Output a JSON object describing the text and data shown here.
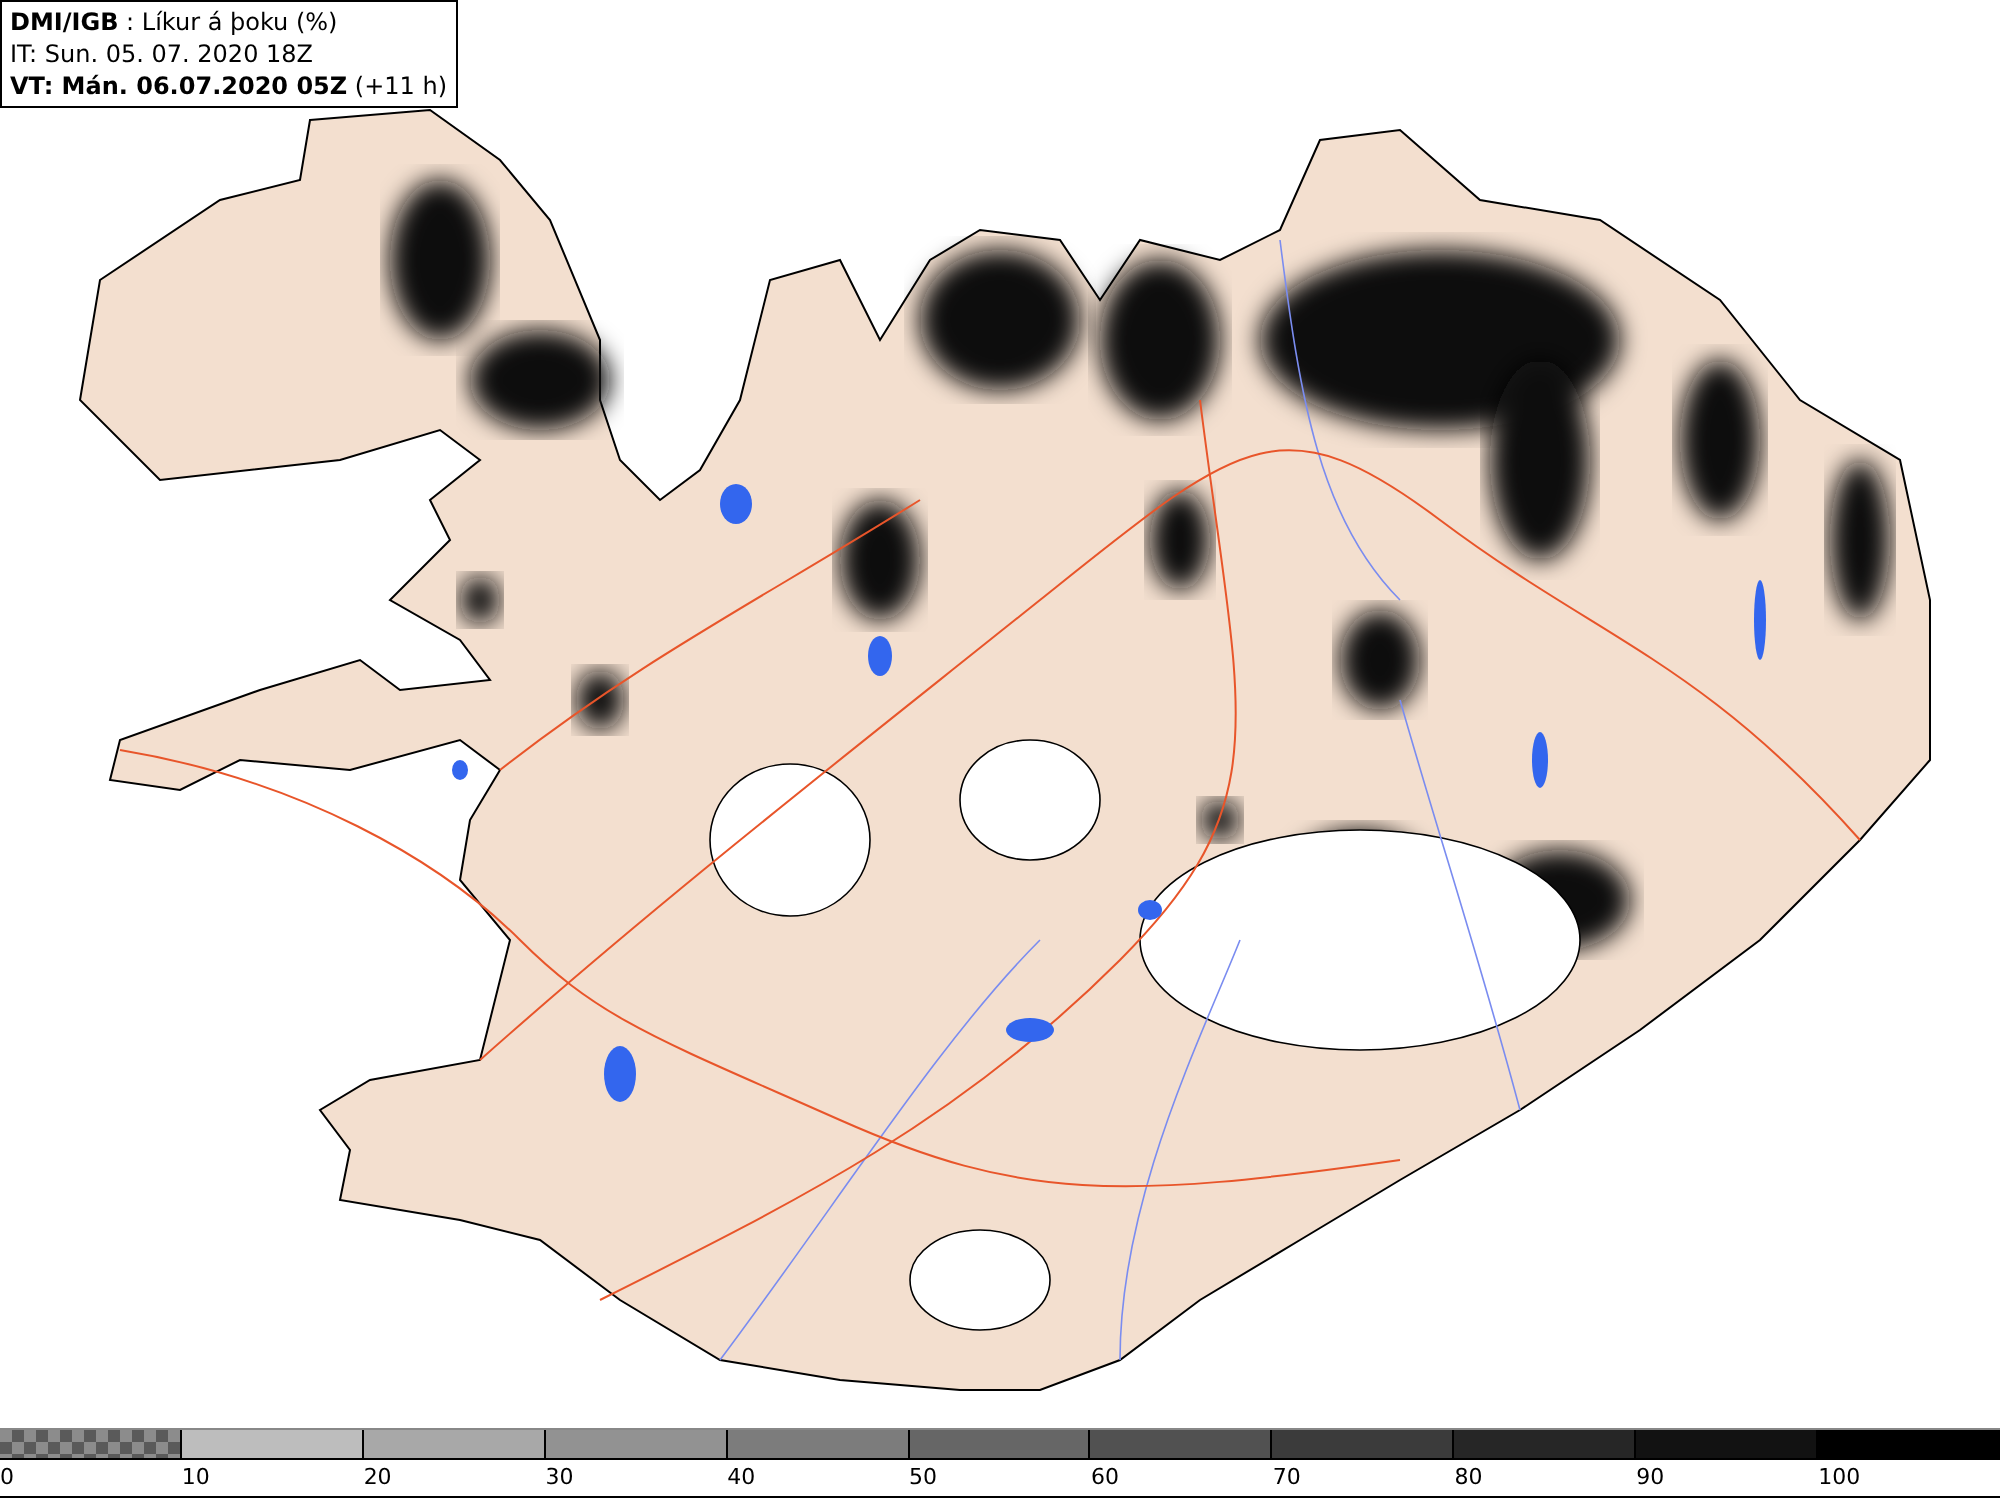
{
  "header": {
    "lines": [
      "**DMI/IGB** : Líkur á þoku (%)",
      "IT: Sun. 05. 07. 2020 18Z",
      "**VT: Mán. 06.07.2020 05Z** (+11 h)"
    ]
  },
  "legend": {
    "segments": [
      {
        "kind": "checker",
        "color": "#5a5a5a"
      },
      {
        "kind": "solid",
        "color": "#bdbdbd"
      },
      {
        "kind": "solid",
        "color": "#a8a8a8"
      },
      {
        "kind": "solid",
        "color": "#929292"
      },
      {
        "kind": "solid",
        "color": "#7c7c7c"
      },
      {
        "kind": "solid",
        "color": "#666666"
      },
      {
        "kind": "solid",
        "color": "#515151"
      },
      {
        "kind": "solid",
        "color": "#3b3b3b"
      },
      {
        "kind": "solid",
        "color": "#262626"
      },
      {
        "kind": "solid",
        "color": "#121212"
      },
      {
        "kind": "solid",
        "color": "#000000"
      }
    ],
    "labels": [
      "0",
      "10",
      "20",
      "30",
      "40",
      "50",
      "60",
      "70",
      "80",
      "90",
      "100"
    ]
  }
}
